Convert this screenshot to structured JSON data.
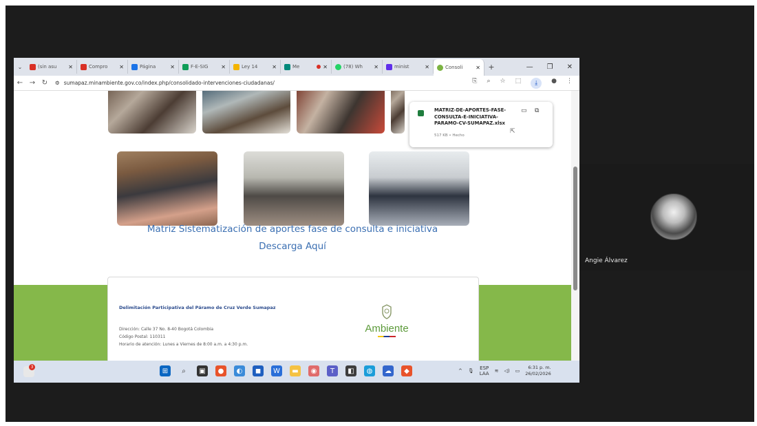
{
  "browser": {
    "tabs": [
      {
        "label": "(sin asu",
        "icon": "gmail-icon",
        "color": "#d93025"
      },
      {
        "label": "Compro",
        "icon": "gmail-icon",
        "color": "#d93025"
      },
      {
        "label": "Página",
        "icon": "drive-icon",
        "color": "#1a73e8"
      },
      {
        "label": "F-E-SIG",
        "icon": "sheets-icon",
        "color": "#0f9d58"
      },
      {
        "label": "Ley 14",
        "icon": "shield-icon",
        "color": "#f4b400"
      },
      {
        "label": "Me",
        "icon": "meet-icon",
        "color": "#00897b"
      },
      {
        "label": "(78) Wh",
        "icon": "whatsapp-icon",
        "color": "#25d366"
      },
      {
        "label": "minist",
        "icon": "doc-icon",
        "color": "#5f2eea"
      },
      {
        "label": "Consoli",
        "icon": "site-icon",
        "color": "#7cb342"
      }
    ],
    "url": "sumapaz.minambiente.gov.co/index.php/consolidado-intervenciones-ciudadanas/"
  },
  "download": {
    "filename": "MATRIZ-DE-APORTES-FASE-CONSULTA-E-INICIATIVA-PARAMO-CV-SUMAPAZ.xlsx",
    "meta": "517 KB • Hecho"
  },
  "page": {
    "title": "Matriz Sistematización de aportes fase de consulta e iniciativa",
    "download_link": "Descarga Aquí",
    "footer": {
      "heading": "Delimitación Participativa del Páramo de Cruz Verde Sumapaz",
      "address": "Dirección: Calle 37 No. 8-40 Bogotá Colombia",
      "postal": "Código Postal: 110311",
      "hours": "Horario de atención: Lunes a Viernes de 8:00 a.m. a 4:30 p.m.",
      "logo": "Ambiente"
    }
  },
  "taskbar": {
    "badge": "3",
    "lang_top": "ESP",
    "lang_bottom": "LAA",
    "time": "6:31 p. m.",
    "date": "26/02/2026"
  },
  "participant": {
    "name": "Angie Álvarez"
  }
}
